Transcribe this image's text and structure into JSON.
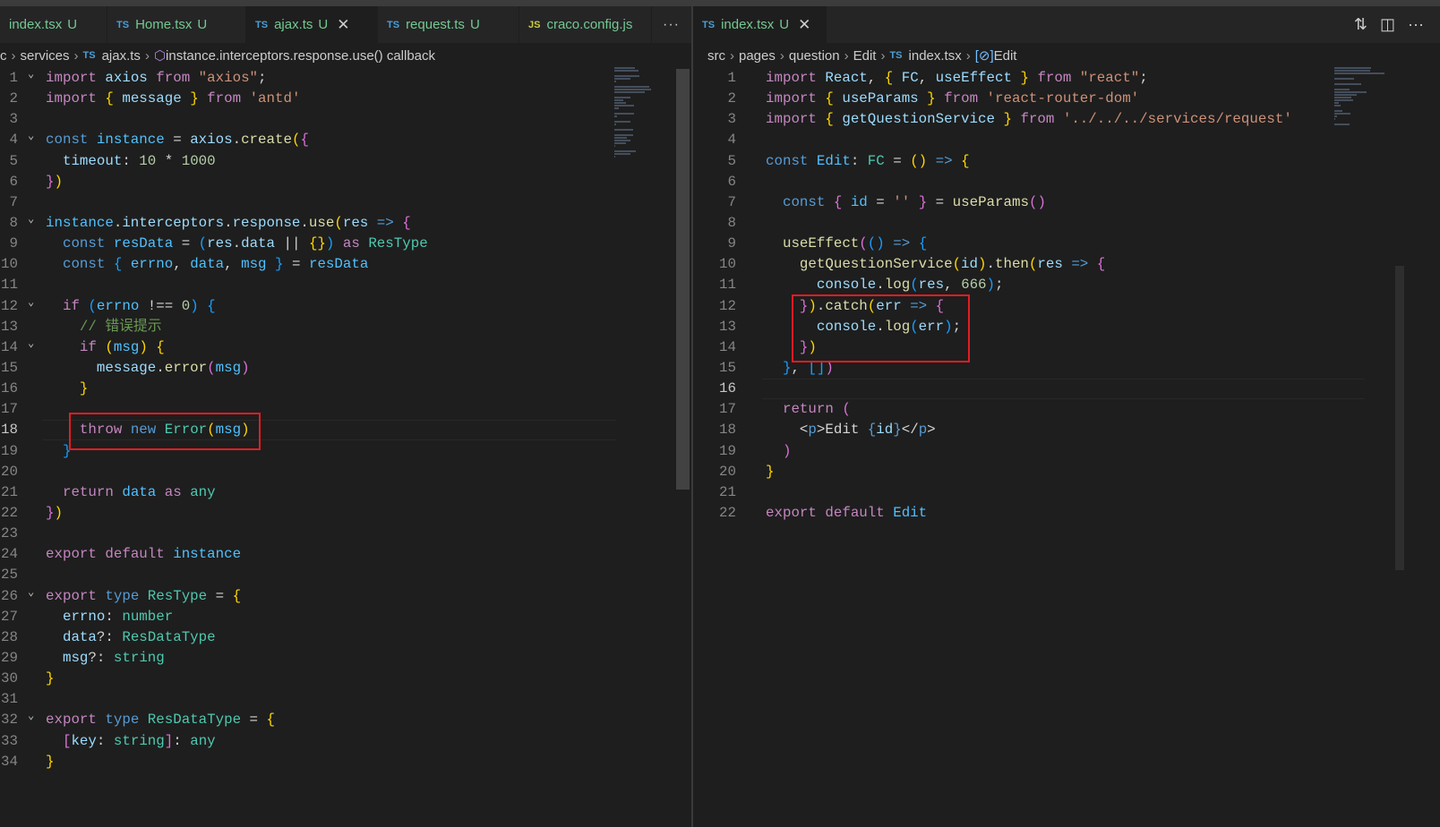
{
  "left": {
    "tabs": [
      {
        "label": "index.tsx",
        "badge": "U",
        "lang": "",
        "active": false
      },
      {
        "label": "Home.tsx",
        "badge": "U",
        "lang": "TS",
        "active": false
      },
      {
        "label": "ajax.ts",
        "badge": "U",
        "lang": "TS",
        "active": true
      },
      {
        "label": "request.ts",
        "badge": "U",
        "lang": "TS",
        "active": false
      },
      {
        "label": "craco.config.js",
        "badge": "",
        "lang": "JS",
        "active": false
      }
    ],
    "more": "···",
    "breadcrumb": [
      "c",
      "services",
      "ajax.ts",
      "instance.interceptors.response.use() callback"
    ],
    "current_line": 18,
    "lines": [
      [
        [
          "c",
          "import"
        ],
        [
          "p",
          " "
        ],
        [
          "v",
          "axios"
        ],
        [
          "p",
          " "
        ],
        [
          "c",
          "from"
        ],
        [
          "p",
          " "
        ],
        [
          "s",
          "\"axios\""
        ],
        [
          "p",
          ";"
        ]
      ],
      [
        [
          "c",
          "import"
        ],
        [
          "p",
          " "
        ],
        [
          "b1",
          "{"
        ],
        [
          "p",
          " "
        ],
        [
          "v",
          "message"
        ],
        [
          "p",
          " "
        ],
        [
          "b1",
          "}"
        ],
        [
          "p",
          " "
        ],
        [
          "c",
          "from"
        ],
        [
          "p",
          " "
        ],
        [
          "s",
          "'antd'"
        ]
      ],
      [],
      [
        [
          "k",
          "const"
        ],
        [
          "p",
          " "
        ],
        [
          "o",
          "instance"
        ],
        [
          "p",
          " = "
        ],
        [
          "v",
          "axios"
        ],
        [
          "p",
          "."
        ],
        [
          "f",
          "create"
        ],
        [
          "b1",
          "("
        ],
        [
          "b2",
          "{"
        ]
      ],
      [
        [
          "p",
          "  "
        ],
        [
          "v",
          "timeout"
        ],
        [
          "p",
          ": "
        ],
        [
          "n",
          "10"
        ],
        [
          "p",
          " * "
        ],
        [
          "n",
          "1000"
        ]
      ],
      [
        [
          "b2",
          "}"
        ],
        [
          "b1",
          ")"
        ]
      ],
      [],
      [
        [
          "o",
          "instance"
        ],
        [
          "p",
          "."
        ],
        [
          "v",
          "interceptors"
        ],
        [
          "p",
          "."
        ],
        [
          "v",
          "response"
        ],
        [
          "p",
          "."
        ],
        [
          "f",
          "use"
        ],
        [
          "b1",
          "("
        ],
        [
          "v",
          "res"
        ],
        [
          "p",
          " "
        ],
        [
          "k",
          "=>"
        ],
        [
          "p",
          " "
        ],
        [
          "b2",
          "{"
        ]
      ],
      [
        [
          "p",
          "  "
        ],
        [
          "k",
          "const"
        ],
        [
          "p",
          " "
        ],
        [
          "o",
          "resData"
        ],
        [
          "p",
          " = "
        ],
        [
          "b3",
          "("
        ],
        [
          "v",
          "res"
        ],
        [
          "p",
          "."
        ],
        [
          "v",
          "data"
        ],
        [
          "p",
          " || "
        ],
        [
          "b1",
          "{}"
        ],
        [
          "b3",
          ")"
        ],
        [
          "p",
          " "
        ],
        [
          "c",
          "as"
        ],
        [
          "p",
          " "
        ],
        [
          "t",
          "ResType"
        ]
      ],
      [
        [
          "p",
          "  "
        ],
        [
          "k",
          "const"
        ],
        [
          "p",
          " "
        ],
        [
          "b3",
          "{"
        ],
        [
          "p",
          " "
        ],
        [
          "o",
          "errno"
        ],
        [
          "p",
          ", "
        ],
        [
          "o",
          "data"
        ],
        [
          "p",
          ", "
        ],
        [
          "o",
          "msg"
        ],
        [
          "p",
          " "
        ],
        [
          "b3",
          "}"
        ],
        [
          "p",
          " = "
        ],
        [
          "o",
          "resData"
        ]
      ],
      [],
      [
        [
          "p",
          "  "
        ],
        [
          "c",
          "if"
        ],
        [
          "p",
          " "
        ],
        [
          "b3",
          "("
        ],
        [
          "o",
          "errno"
        ],
        [
          "p",
          " !== "
        ],
        [
          "n",
          "0"
        ],
        [
          "b3",
          ")"
        ],
        [
          "p",
          " "
        ],
        [
          "b3",
          "{"
        ]
      ],
      [
        [
          "p",
          "    "
        ],
        [
          "m",
          "// 错误提示"
        ]
      ],
      [
        [
          "p",
          "    "
        ],
        [
          "c",
          "if"
        ],
        [
          "p",
          " "
        ],
        [
          "b1",
          "("
        ],
        [
          "o",
          "msg"
        ],
        [
          "b1",
          ")"
        ],
        [
          "p",
          " "
        ],
        [
          "b1",
          "{"
        ]
      ],
      [
        [
          "p",
          "      "
        ],
        [
          "v",
          "message"
        ],
        [
          "p",
          "."
        ],
        [
          "f",
          "error"
        ],
        [
          "b2",
          "("
        ],
        [
          "o",
          "msg"
        ],
        [
          "b2",
          ")"
        ]
      ],
      [
        [
          "p",
          "    "
        ],
        [
          "b1",
          "}"
        ]
      ],
      [],
      [
        [
          "p",
          "    "
        ],
        [
          "c",
          "throw"
        ],
        [
          "p",
          " "
        ],
        [
          "k",
          "new"
        ],
        [
          "p",
          " "
        ],
        [
          "t",
          "Error"
        ],
        [
          "b1",
          "("
        ],
        [
          "o",
          "msg"
        ],
        [
          "b1",
          ")"
        ]
      ],
      [
        [
          "p",
          "  "
        ],
        [
          "b3",
          "}"
        ]
      ],
      [],
      [
        [
          "p",
          "  "
        ],
        [
          "c",
          "return"
        ],
        [
          "p",
          " "
        ],
        [
          "o",
          "data"
        ],
        [
          "p",
          " "
        ],
        [
          "c",
          "as"
        ],
        [
          "p",
          " "
        ],
        [
          "t",
          "any"
        ]
      ],
      [
        [
          "b2",
          "}"
        ],
        [
          "b1",
          ")"
        ]
      ],
      [],
      [
        [
          "c",
          "export"
        ],
        [
          "p",
          " "
        ],
        [
          "c",
          "default"
        ],
        [
          "p",
          " "
        ],
        [
          "o",
          "instance"
        ]
      ],
      [],
      [
        [
          "c",
          "export"
        ],
        [
          "p",
          " "
        ],
        [
          "k",
          "type"
        ],
        [
          "p",
          " "
        ],
        [
          "t",
          "ResType"
        ],
        [
          "p",
          " = "
        ],
        [
          "b1",
          "{"
        ]
      ],
      [
        [
          "p",
          "  "
        ],
        [
          "v",
          "errno"
        ],
        [
          "p",
          ": "
        ],
        [
          "t",
          "number"
        ]
      ],
      [
        [
          "p",
          "  "
        ],
        [
          "v",
          "data"
        ],
        [
          "p",
          "?: "
        ],
        [
          "t",
          "ResDataType"
        ]
      ],
      [
        [
          "p",
          "  "
        ],
        [
          "v",
          "msg"
        ],
        [
          "p",
          "?: "
        ],
        [
          "t",
          "string"
        ]
      ],
      [
        [
          "b1",
          "}"
        ]
      ],
      [],
      [
        [
          "c",
          "export"
        ],
        [
          "p",
          " "
        ],
        [
          "k",
          "type"
        ],
        [
          "p",
          " "
        ],
        [
          "t",
          "ResDataType"
        ],
        [
          "p",
          " = "
        ],
        [
          "b1",
          "{"
        ]
      ],
      [
        [
          "p",
          "  "
        ],
        [
          "b2",
          "["
        ],
        [
          "v",
          "key"
        ],
        [
          "p",
          ": "
        ],
        [
          "t",
          "string"
        ],
        [
          "b2",
          "]"
        ],
        [
          "p",
          ": "
        ],
        [
          "t",
          "any"
        ]
      ],
      [
        [
          "b1",
          "}"
        ]
      ]
    ],
    "folds": [
      1,
      4,
      8,
      12,
      14,
      26,
      32
    ]
  },
  "right": {
    "tabs": [
      {
        "label": "index.tsx",
        "badge": "U",
        "lang": "TS",
        "active": true
      }
    ],
    "actions": {
      "compare": "compare-changes-icon",
      "split": "split-editor-icon",
      "more": "···"
    },
    "breadcrumb": [
      "src",
      "pages",
      "question",
      "Edit",
      "index.tsx",
      "Edit"
    ],
    "current_line": 16,
    "lines": [
      [
        [
          "c",
          "import"
        ],
        [
          "p",
          " "
        ],
        [
          "v",
          "React"
        ],
        [
          "p",
          ", "
        ],
        [
          "b1",
          "{"
        ],
        [
          "p",
          " "
        ],
        [
          "v",
          "FC"
        ],
        [
          "p",
          ", "
        ],
        [
          "v",
          "useEffect"
        ],
        [
          "p",
          " "
        ],
        [
          "b1",
          "}"
        ],
        [
          "p",
          " "
        ],
        [
          "c",
          "from"
        ],
        [
          "p",
          " "
        ],
        [
          "s",
          "\"react\""
        ],
        [
          "p",
          ";"
        ]
      ],
      [
        [
          "c",
          "import"
        ],
        [
          "p",
          " "
        ],
        [
          "b1",
          "{"
        ],
        [
          "p",
          " "
        ],
        [
          "v",
          "useParams"
        ],
        [
          "p",
          " "
        ],
        [
          "b1",
          "}"
        ],
        [
          "p",
          " "
        ],
        [
          "c",
          "from"
        ],
        [
          "p",
          " "
        ],
        [
          "s",
          "'react-router-dom'"
        ]
      ],
      [
        [
          "c",
          "import"
        ],
        [
          "p",
          " "
        ],
        [
          "b1",
          "{"
        ],
        [
          "p",
          " "
        ],
        [
          "v",
          "getQuestionService"
        ],
        [
          "p",
          " "
        ],
        [
          "b1",
          "}"
        ],
        [
          "p",
          " "
        ],
        [
          "c",
          "from"
        ],
        [
          "p",
          " "
        ],
        [
          "s",
          "'../../../services/request'"
        ]
      ],
      [],
      [
        [
          "k",
          "const"
        ],
        [
          "p",
          " "
        ],
        [
          "o",
          "Edit"
        ],
        [
          "p",
          ": "
        ],
        [
          "t",
          "FC"
        ],
        [
          "p",
          " = "
        ],
        [
          "b1",
          "()"
        ],
        [
          "p",
          " "
        ],
        [
          "k",
          "=>"
        ],
        [
          "p",
          " "
        ],
        [
          "b1",
          "{"
        ]
      ],
      [],
      [
        [
          "p",
          "  "
        ],
        [
          "k",
          "const"
        ],
        [
          "p",
          " "
        ],
        [
          "b2",
          "{"
        ],
        [
          "p",
          " "
        ],
        [
          "o",
          "id"
        ],
        [
          "p",
          " = "
        ],
        [
          "s",
          "''"
        ],
        [
          "p",
          " "
        ],
        [
          "b2",
          "}"
        ],
        [
          "p",
          " = "
        ],
        [
          "f",
          "useParams"
        ],
        [
          "b2",
          "()"
        ]
      ],
      [],
      [
        [
          "p",
          "  "
        ],
        [
          "f",
          "useEffect"
        ],
        [
          "b2",
          "("
        ],
        [
          "b3",
          "()"
        ],
        [
          "p",
          " "
        ],
        [
          "k",
          "=>"
        ],
        [
          "p",
          " "
        ],
        [
          "b3",
          "{"
        ]
      ],
      [
        [
          "p",
          "    "
        ],
        [
          "f",
          "getQuestionService"
        ],
        [
          "b1",
          "("
        ],
        [
          "v",
          "id"
        ],
        [
          "b1",
          ")"
        ],
        [
          "p",
          "."
        ],
        [
          "f",
          "then"
        ],
        [
          "b1",
          "("
        ],
        [
          "v",
          "res"
        ],
        [
          "p",
          " "
        ],
        [
          "k",
          "=>"
        ],
        [
          "p",
          " "
        ],
        [
          "b2",
          "{"
        ]
      ],
      [
        [
          "p",
          "      "
        ],
        [
          "v",
          "console"
        ],
        [
          "p",
          "."
        ],
        [
          "f",
          "log"
        ],
        [
          "b3",
          "("
        ],
        [
          "v",
          "res"
        ],
        [
          "p",
          ", "
        ],
        [
          "n",
          "666"
        ],
        [
          "b3",
          ")"
        ],
        [
          "p",
          ";"
        ]
      ],
      [
        [
          "p",
          "    "
        ],
        [
          "b2",
          "}"
        ],
        [
          "b1",
          ")"
        ],
        [
          "p",
          "."
        ],
        [
          "f",
          "catch"
        ],
        [
          "b1",
          "("
        ],
        [
          "v",
          "err"
        ],
        [
          "p",
          " "
        ],
        [
          "k",
          "=>"
        ],
        [
          "p",
          " "
        ],
        [
          "b2",
          "{"
        ]
      ],
      [
        [
          "p",
          "      "
        ],
        [
          "v",
          "console"
        ],
        [
          "p",
          "."
        ],
        [
          "f",
          "log"
        ],
        [
          "b3",
          "("
        ],
        [
          "v",
          "err"
        ],
        [
          "b3",
          ")"
        ],
        [
          "p",
          ";"
        ]
      ],
      [
        [
          "p",
          "    "
        ],
        [
          "b2",
          "}"
        ],
        [
          "b1",
          ")"
        ]
      ],
      [
        [
          "p",
          "  "
        ],
        [
          "b3",
          "}"
        ],
        [
          "p",
          ", "
        ],
        [
          "b3",
          "[]"
        ],
        [
          "b2",
          ")"
        ]
      ],
      [],
      [
        [
          "p",
          "  "
        ],
        [
          "c",
          "return"
        ],
        [
          "p",
          " "
        ],
        [
          "b2",
          "("
        ]
      ],
      [
        [
          "p",
          "    "
        ],
        [
          "p",
          "<"
        ],
        [
          "k",
          "p"
        ],
        [
          "p",
          ">"
        ],
        [
          "p",
          "Edit "
        ],
        [
          "k",
          "{"
        ],
        [
          "v",
          "id"
        ],
        [
          "k",
          "}"
        ],
        [
          "p",
          "</"
        ],
        [
          "k",
          "p"
        ],
        [
          "p",
          ">"
        ]
      ],
      [
        [
          "p",
          "  "
        ],
        [
          "b2",
          ")"
        ]
      ],
      [
        [
          "b1",
          "}"
        ]
      ],
      [],
      [
        [
          "c",
          "export"
        ],
        [
          "p",
          " "
        ],
        [
          "c",
          "default"
        ],
        [
          "p",
          " "
        ],
        [
          "o",
          "Edit"
        ]
      ]
    ]
  }
}
